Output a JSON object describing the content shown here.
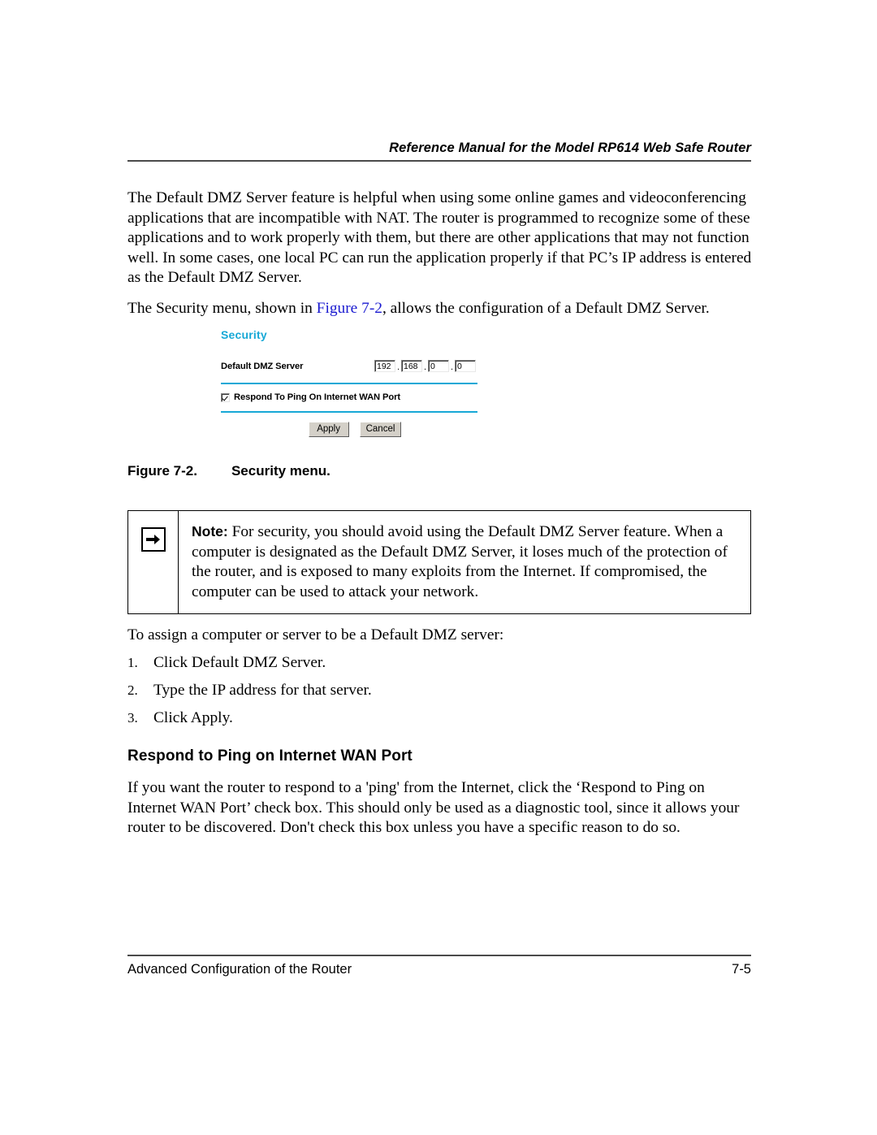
{
  "header": {
    "title": "Reference Manual for the Model RP614 Web Safe Router"
  },
  "main": {
    "paragraph_1": "The Default DMZ Server feature is helpful when using some online games and videoconferencing applications that are incompatible with NAT. The router is programmed to recognize some of these applications and to work properly with them, but there are other applications that may not function well. In some cases, one local PC can run the application properly if that PC’s IP address is entered as the Default DMZ Server.",
    "paragraph_2_before_link": "The Security menu, shown in ",
    "paragraph_2_link": "Figure 7-2",
    "paragraph_2_after_link": ", allows the configuration of a Default DMZ Server.",
    "assign_intro": "To assign a computer or server to be a Default DMZ server:",
    "steps": [
      {
        "marker": "1.",
        "text": "Click Default DMZ Server."
      },
      {
        "marker": "2.",
        "text": "Type the IP address for that server."
      },
      {
        "marker": "3.",
        "text": "Click Apply."
      }
    ],
    "section_heading": "Respond to Ping on Internet WAN Port",
    "ping_paragraph": "If you want the router to respond to a 'ping' from the Internet, click the ‘Respond to Ping on Internet WAN Port’ check box. This should only be used as a diagnostic tool, since it allows your router to be discovered. Don't check this box unless you have a specific reason to do so."
  },
  "figure": {
    "screenshot": {
      "heading": "Security",
      "dmz_label": "Default DMZ Server",
      "ip_octets": [
        "192",
        "168",
        "0",
        "0"
      ],
      "ip_separator": ".",
      "ping_checkbox_label": "Respond To Ping On Internet WAN Port",
      "ping_checkbox_checked": "checked",
      "apply_label": "Apply",
      "cancel_label": "Cancel",
      "accent_color": "#17a8d6"
    },
    "caption_number": "Figure 7-2.",
    "caption_text": "Security menu."
  },
  "note": {
    "icon_name": "right-arrow-icon",
    "keyword": "Note:",
    "body": " For security, you should avoid using the Default DMZ Server feature. When a computer is designated as the Default DMZ Server, it loses much of the protection of the router, and is exposed to many exploits from the Internet. If compromised, the computer can be used to attack your network."
  },
  "footer": {
    "left": "Advanced Configuration of the Router",
    "right": "7-5"
  }
}
